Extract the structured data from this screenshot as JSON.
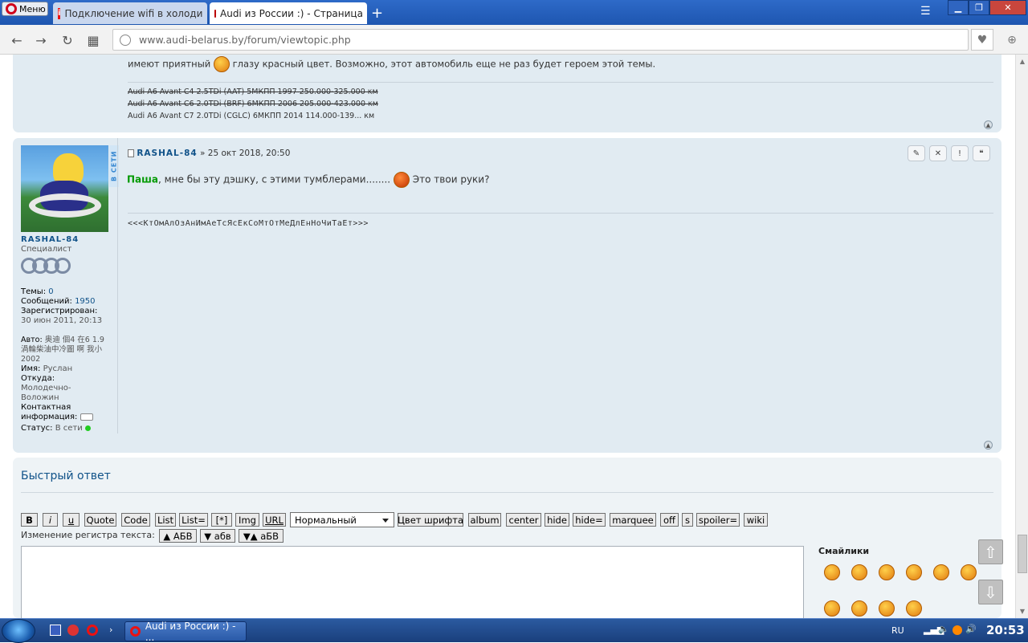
{
  "browser": {
    "menu_label": "Меню",
    "tabs": [
      {
        "title": "Подключение wifi в холоди"
      },
      {
        "title": "Audi из России :) - Страница"
      }
    ],
    "new_tab": "+",
    "url": "www.audi-belarus.by/forum/viewtopic.php"
  },
  "prev_post": {
    "text_before": "имеют приятный",
    "text_after": "глазу красный цвет. Возможно, этот автомобиль еще не раз будет героем этой темы.",
    "signature": [
      "Audi A6 Avant C4 2.5TDi (AAT) 5МКПП 1997 250.000-325.000 км",
      "Audi A6 Avant C6 2.0TDi (BRF) 6МКПП 2006 205.000-423.000 км",
      "Audi A6 Avant C7 2.0TDi (CGLC) 6МКПП 2014 114.000-139... км"
    ]
  },
  "post": {
    "author": "RASHAL-84",
    "date": "» 25 окт 2018, 20:50",
    "online_badge": "В СЕТИ",
    "mention": "Паша",
    "text_part1": ", мне бы эту дэшку, с этими тумблерами........",
    "text_part2": "Это твои руки?",
    "signature": "<<<КтОмАлОзАнИмАеТсЯсЕкСоМтОтМеДлЕнНоЧиТаЕт>>>",
    "buttons": [
      "✎",
      "✕",
      "!",
      "❝"
    ]
  },
  "profile": {
    "name": "RASHAL-84",
    "rank": "Специалист",
    "topics_label": "Темы:",
    "topics_value": "0",
    "posts_label": "Сообщений:",
    "posts_value": "1950",
    "registered_label": "Зарегистрирован:",
    "registered_value": "30 июн 2011, 20:13",
    "auto_label": "Авто:",
    "auto_value": "奥迪 個4 在6 1.9 渦輪柴油中冷圖 啊 我小 2002",
    "name_label": "Имя:",
    "name_value": "Руслан",
    "from_label": "Откуда:",
    "from_value": "Молодечно-Воложин",
    "contact_label": "Контактная информация:",
    "status_label": "Статус:",
    "status_value": "В сети"
  },
  "quick_reply": {
    "title": "Быстрый ответ",
    "toolbar": [
      "B",
      "i",
      "u",
      "Quote",
      "Code",
      "List",
      "List=",
      "[*]",
      "Img",
      "URL"
    ],
    "font_size_select": "Нормальный",
    "toolbar2": [
      "Цвет шрифта",
      "album",
      "center",
      "hide",
      "hide=",
      "marquee",
      "off",
      "s",
      "spoiler=",
      "wiki"
    ],
    "case_label": "Изменение регистра текста:",
    "case_buttons": [
      "▲ АБВ",
      "▼ абв",
      "▼▲ аБВ"
    ],
    "smilies_title": "Смайлики"
  },
  "taskbar": {
    "task_label": "Audi из России :) - ...",
    "lang": "RU",
    "clock": "20:53"
  },
  "colors": {
    "post_bg": "#e1ebf2",
    "link": "#105289",
    "mention": "#009900"
  }
}
